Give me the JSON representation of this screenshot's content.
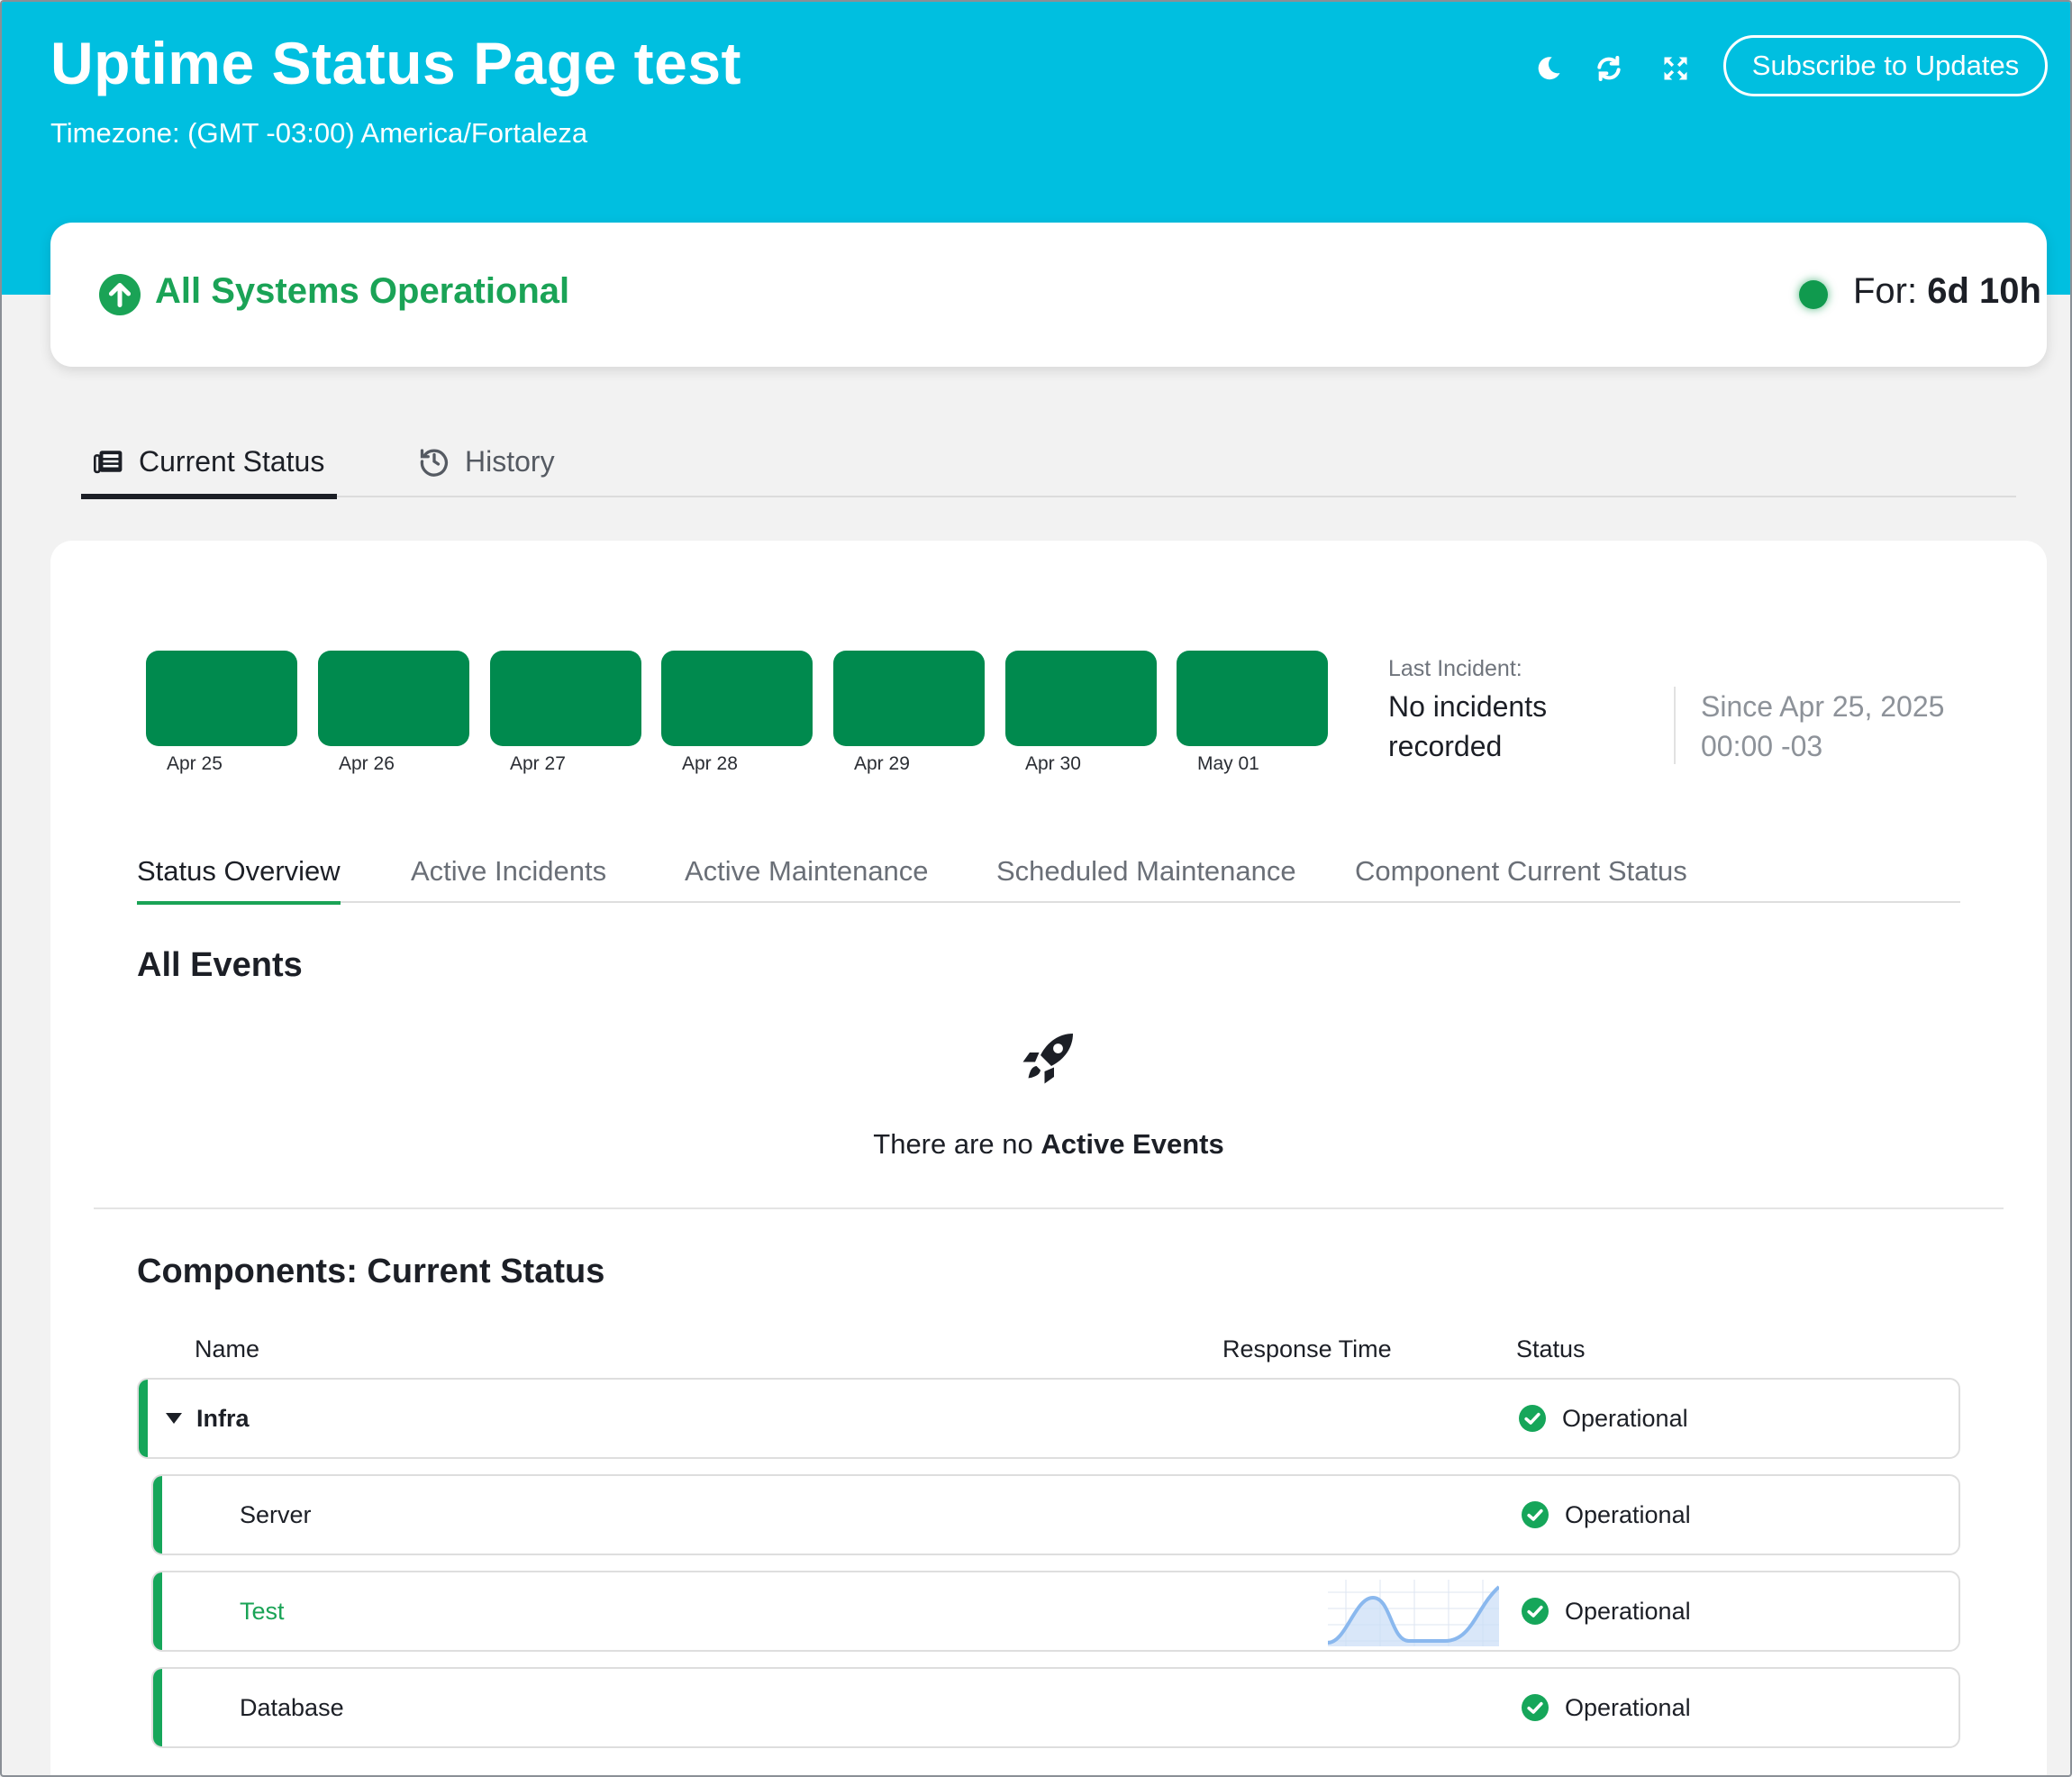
{
  "header": {
    "title": "Uptime Status Page test",
    "timezone": "Timezone: (GMT -03:00) America/Fortaleza",
    "subscribe_label": "Subscribe to Updates"
  },
  "overall_status": {
    "text": "All Systems Operational",
    "for_label": "For:",
    "for_value": "6d 10h"
  },
  "main_tabs": [
    {
      "label": "Current Status",
      "icon": "newspaper-icon"
    },
    {
      "label": "History",
      "icon": "history-icon"
    }
  ],
  "uptime_days": [
    {
      "label": "Apr 25",
      "status": "operational"
    },
    {
      "label": "Apr 26",
      "status": "operational"
    },
    {
      "label": "Apr 27",
      "status": "operational"
    },
    {
      "label": "Apr 28",
      "status": "operational"
    },
    {
      "label": "Apr 29",
      "status": "operational"
    },
    {
      "label": "Apr 30",
      "status": "operational"
    },
    {
      "label": "May 01",
      "status": "operational"
    }
  ],
  "last_incident": {
    "label": "Last Incident:",
    "value": "No incidents recorded",
    "since": "Since Apr 25, 2025 00:00 -03"
  },
  "sub_tabs": [
    "Status Overview",
    "Active Incidents",
    "Active Maintenance",
    "Scheduled Maintenance",
    "Component Current Status"
  ],
  "events": {
    "title": "All Events",
    "empty_prefix": "There are no",
    "empty_bold": "Active Events"
  },
  "components": {
    "title": "Components: Current Status",
    "columns": {
      "name": "Name",
      "response_time": "Response Time",
      "status": "Status"
    },
    "rows": [
      {
        "name": "Infra",
        "status": "Operational",
        "group": true
      },
      {
        "name": "Server",
        "status": "Operational"
      },
      {
        "name": "Test",
        "status": "Operational",
        "has_sparkline": true
      },
      {
        "name": "Database",
        "status": "Operational"
      }
    ]
  },
  "colors": {
    "hero": "#00bfe0",
    "operational": "#008a4e",
    "accent_green": "#1aa356"
  }
}
